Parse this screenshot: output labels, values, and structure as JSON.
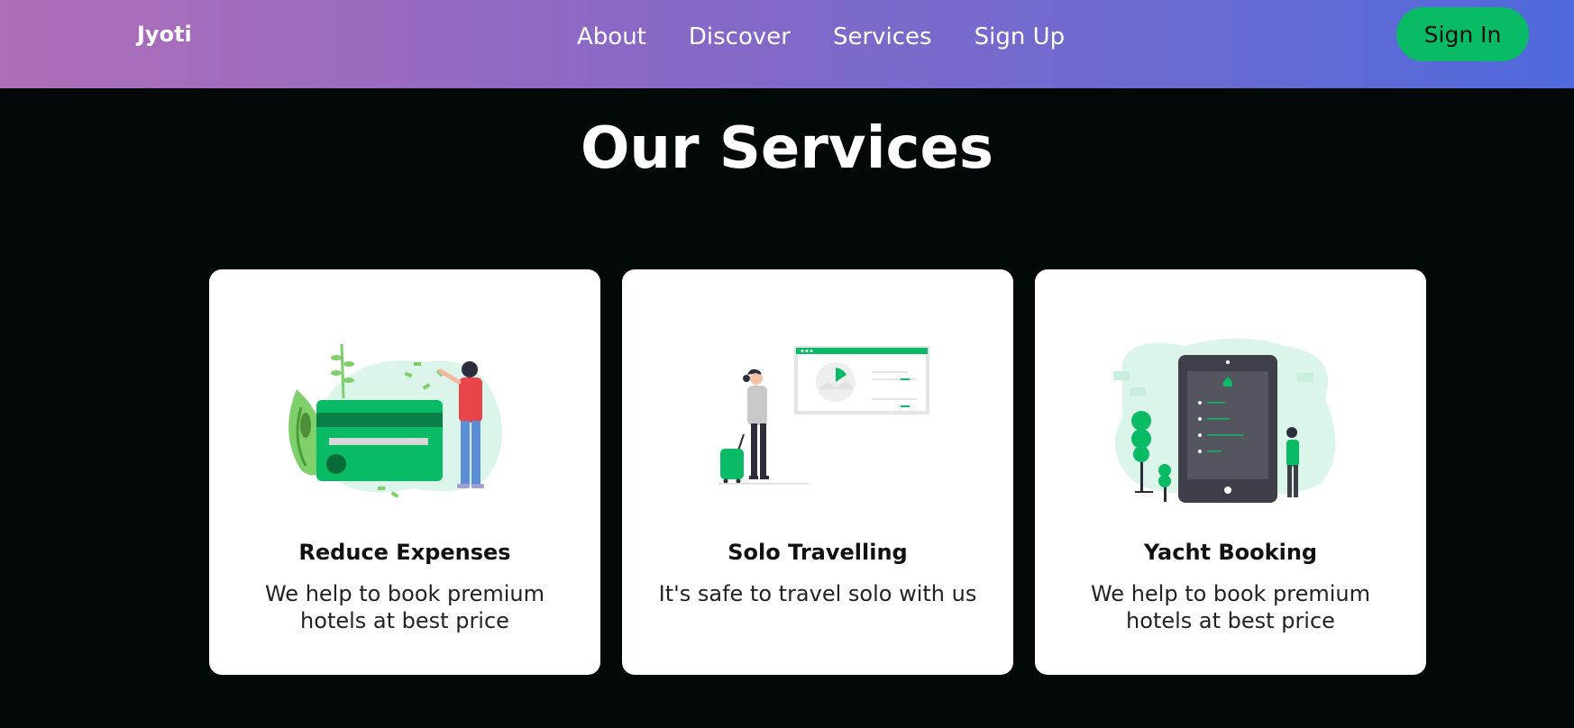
{
  "nav": {
    "logo": "Jyoti",
    "links": [
      "About",
      "Discover",
      "Services",
      "Sign Up"
    ],
    "signin_label": "Sign In"
  },
  "services": {
    "title": "Our Services",
    "cards": [
      {
        "title": "Reduce Expenses",
        "text": "We help to book premium hotels at best price",
        "illustration": "credit-card-money-illustration"
      },
      {
        "title": "Solo Travelling",
        "text": "It's safe to travel solo with us",
        "illustration": "traveler-with-suitcase-illustration"
      },
      {
        "title": "Yacht Booking",
        "text": "We help to book premium hotels at best price",
        "illustration": "tablet-booking-illustration"
      }
    ]
  },
  "colors": {
    "accent": "#0abb66",
    "nav_gradient_start": "#b06fb8",
    "nav_gradient_end": "#4f69dc",
    "background": "#030809"
  }
}
